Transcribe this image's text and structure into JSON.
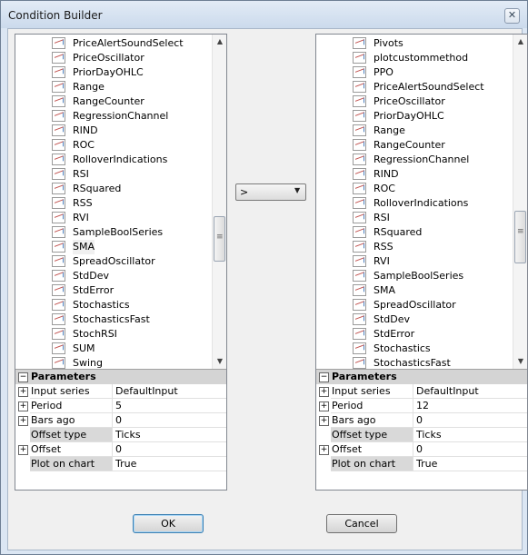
{
  "window": {
    "title": "Condition Builder",
    "close_glyph": "✕"
  },
  "left_panel": {
    "items": [
      "PriceAlertSoundSelect",
      "PriceOscillator",
      "PriorDayOHLC",
      "Range",
      "RangeCounter",
      "RegressionChannel",
      "RIND",
      "ROC",
      "RolloverIndications",
      "RSI",
      "RSquared",
      "RSS",
      "RVI",
      "SampleBoolSeries",
      "SMA",
      "SpreadOscillator",
      "StdDev",
      "StdError",
      "Stochastics",
      "StochasticsFast",
      "StochRSI",
      "SUM",
      "Swing"
    ],
    "selected": "SMA",
    "parameters": {
      "header": "Parameters",
      "rows": [
        {
          "name": "Input series",
          "value": "DefaultInput",
          "expandable": true
        },
        {
          "name": "Period",
          "value": "5",
          "expandable": true
        },
        {
          "name": "Bars ago",
          "value": "0",
          "expandable": true
        },
        {
          "name": "Offset type",
          "value": "Ticks",
          "expandable": false
        },
        {
          "name": "Offset",
          "value": "0",
          "expandable": true
        },
        {
          "name": "Plot on chart",
          "value": "True",
          "expandable": false
        }
      ]
    }
  },
  "operator": {
    "value": ">"
  },
  "right_panel": {
    "items": [
      "Pivots",
      "plotcustommethod",
      "PPO",
      "PriceAlertSoundSelect",
      "PriceOscillator",
      "PriorDayOHLC",
      "Range",
      "RangeCounter",
      "RegressionChannel",
      "RIND",
      "ROC",
      "RolloverIndications",
      "RSI",
      "RSquared",
      "RSS",
      "RVI",
      "SampleBoolSeries",
      "SMA",
      "SpreadOscillator",
      "StdDev",
      "StdError",
      "Stochastics",
      "StochasticsFast"
    ],
    "parameters": {
      "header": "Parameters",
      "rows": [
        {
          "name": "Input series",
          "value": "DefaultInput",
          "expandable": true
        },
        {
          "name": "Period",
          "value": "12",
          "expandable": true
        },
        {
          "name": "Bars ago",
          "value": "0",
          "expandable": true
        },
        {
          "name": "Offset type",
          "value": "Ticks",
          "expandable": false
        },
        {
          "name": "Offset",
          "value": "0",
          "expandable": true
        },
        {
          "name": "Plot on chart",
          "value": "True",
          "expandable": false
        }
      ]
    }
  },
  "buttons": {
    "ok": "OK",
    "cancel": "Cancel"
  },
  "glyphs": {
    "expand": "+",
    "collapse": "−",
    "up": "▲",
    "down": "▼",
    "combo": "▼"
  }
}
